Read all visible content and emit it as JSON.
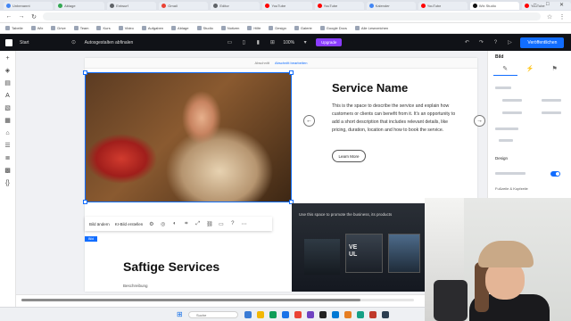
{
  "browser": {
    "tabs": [
      {
        "label": "Unbenannt",
        "color": "#4285f4",
        "active": false
      },
      {
        "label": "Ablage",
        "color": "#34a853",
        "active": false
      },
      {
        "label": "Entwurf",
        "color": "#5f6368",
        "active": false
      },
      {
        "label": "Gmail",
        "color": "#ea4335",
        "active": false
      },
      {
        "label": "Editor",
        "color": "#5f6368",
        "active": false
      },
      {
        "label": "YouTube",
        "color": "#ff0000",
        "active": false
      },
      {
        "label": "YouTube",
        "color": "#ff0000",
        "active": false
      },
      {
        "label": "Kalender",
        "color": "#4285f4",
        "active": false
      },
      {
        "label": "YouTube",
        "color": "#ff0000",
        "active": false
      },
      {
        "label": "Wix Studio",
        "color": "#111111",
        "active": true
      },
      {
        "label": "YouTube",
        "color": "#ff0000",
        "active": false
      }
    ],
    "bookmarks": [
      "Tabelle",
      "Wix",
      "Drive",
      "Team",
      "Kurs",
      "Video",
      "Aufgaben",
      "Ablage",
      "Studio",
      "Notizen",
      "Hilfe",
      "Design",
      "Galerie",
      "Google Docs",
      "Alle Lesezeichen"
    ]
  },
  "editor": {
    "page_label": "Start",
    "site_name": "Autosgestalten abfinalen",
    "zoom": "100%",
    "upgrade_label": "Upgrade",
    "publish_label": "Veröffentlichen"
  },
  "page": {
    "strip_text": "Abschnitt",
    "strip_link": "Abschnitt bearbeiten",
    "service_title": "Service Name",
    "service_desc": "This is the space to describe the service and explain how customers or clients can benefit from it. It's an opportunity to add a short description that includes relevant details, like pricing, duration, location and how to book the service.",
    "learn_more": "Learn More",
    "prev_arrow": "←",
    "next_arrow": "→",
    "toolbar": {
      "replace_image": "Bild ändern",
      "ai_edit": "KI-Bild erstellen"
    },
    "badge": "Bild",
    "section2_title": "Saftige Services",
    "section2_sub": "Beschreibung",
    "lower_caption": "Use this space to promote the business, its products",
    "lower_screen_text": "VE\nUL"
  },
  "inspector": {
    "title": "Bild",
    "design_label": "Design",
    "footer_label": "Fußzeile & Kopfzeile"
  },
  "taskbar": {
    "search_placeholder": "Suche"
  },
  "colors": {
    "accent": "#116dff",
    "editor_bar": "#101217",
    "upgrade": "#8a3cff"
  }
}
